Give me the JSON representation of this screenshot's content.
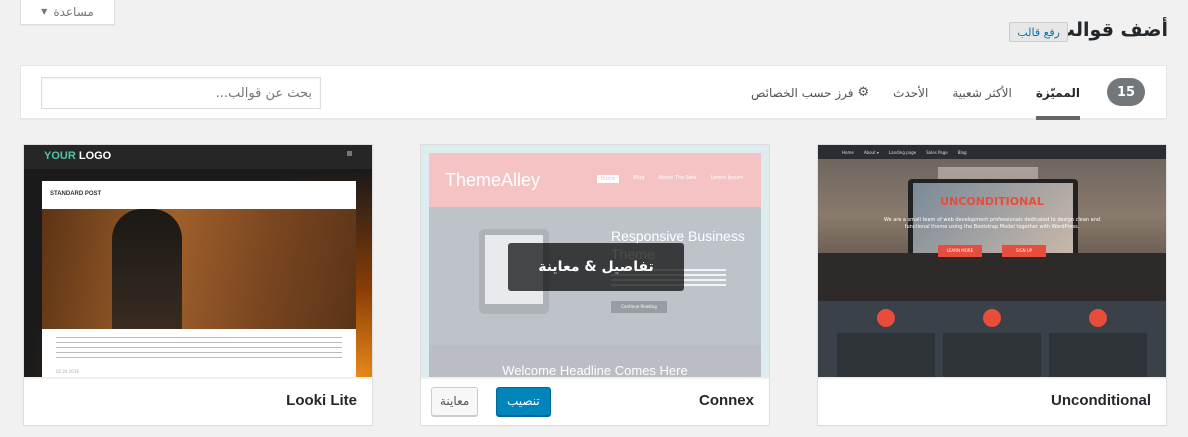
{
  "header": {
    "title": "أضف قوالب",
    "upload_label": "رفع قالب",
    "help_label": "مساعدة"
  },
  "filter": {
    "count": "15",
    "tabs": [
      {
        "label": "المميّزة",
        "current": true
      },
      {
        "label": "الأكثر شعبية",
        "current": false
      },
      {
        "label": "الأحدث",
        "current": false
      }
    ],
    "feature_filter_label": "فرز حسب الخصائص",
    "search_placeholder": "بحث عن قوالب..."
  },
  "themes": [
    {
      "name": "Unconditional",
      "preview": {
        "nav": [
          "Home",
          "About ▾",
          "Landing page",
          "Sales Page",
          "Blog"
        ],
        "heading": "UNCONDITIONAL",
        "subtitle": "We are a small team of web development professionals dedicated to design clean and functional theme using the Bootstrap Model together with WordPress.",
        "btn1": "LEARN MORE",
        "btn2": "SIGN UP"
      }
    },
    {
      "name": "Connex",
      "install_label": "تنصيب",
      "preview_label": "معاينة",
      "details_label": "تفاصيل & معاينة",
      "preview": {
        "logo": "ThemeAlley",
        "nav": [
          "Home",
          "Blog",
          "About The Sets",
          "Lorem Ipsum"
        ],
        "hero_title": "Responsive Business Theme",
        "continue": "Continue Reading",
        "welcome": "Welcome Headline Comes Here"
      }
    },
    {
      "name": "Looki Lite",
      "preview": {
        "logo_a": "YOUR",
        "logo_b": "LOGO",
        "post_title": "STANDARD POST",
        "date": "02.24.2016"
      }
    }
  ],
  "colors": {
    "accent": "#0085ba",
    "badge": "#72777c"
  }
}
